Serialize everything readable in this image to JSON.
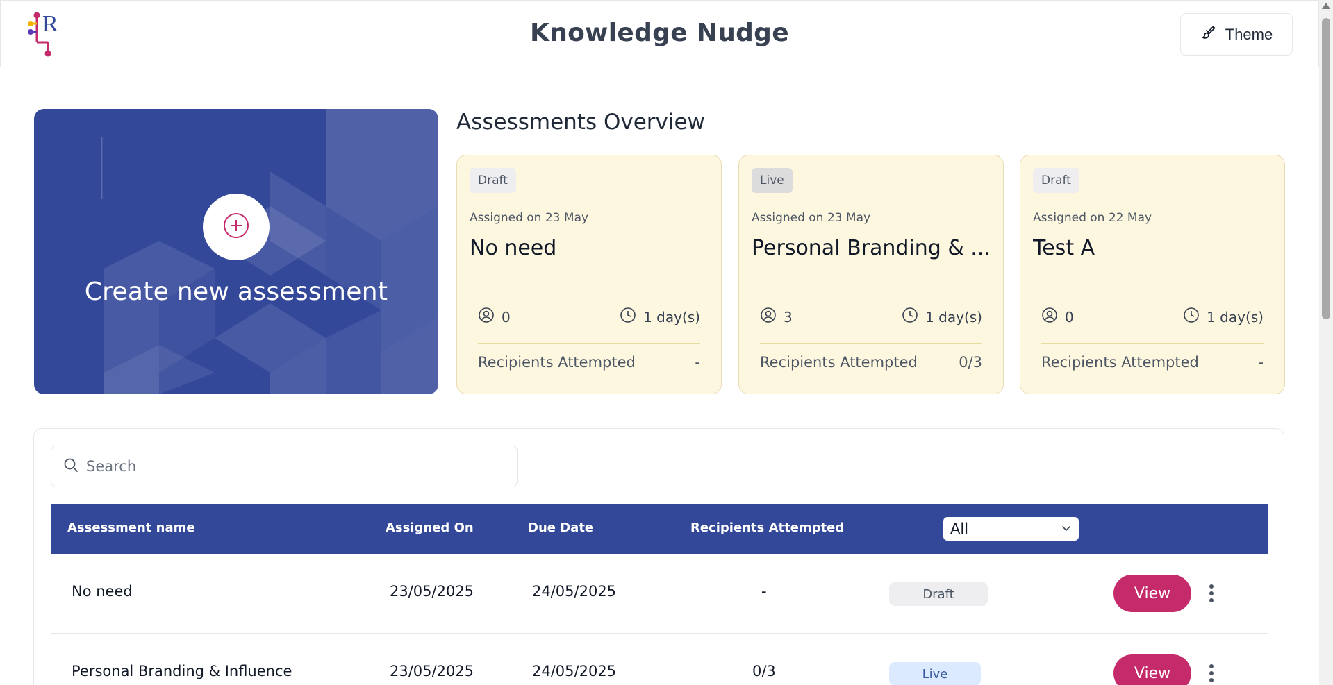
{
  "header": {
    "app_title": "Knowledge Nudge",
    "theme_label": "Theme",
    "logo_icon": "lr-logo-icon",
    "theme_icon": "paintbrush-icon"
  },
  "create_card": {
    "label": "Create new assessment",
    "icon": "plus-circle-icon",
    "accent_color": "#c52a6b",
    "bg_color": "#34489a"
  },
  "overview": {
    "title": "Assessments Overview",
    "cards": [
      {
        "status": "Draft",
        "assigned": "Assigned on 23 May",
        "name": "No need",
        "recipients": "0",
        "duration": "1 day(s)",
        "attempted_label": "Recipients Attempted",
        "attempted_value": "-"
      },
      {
        "status": "Live",
        "assigned": "Assigned on 23 May",
        "name": "Personal Branding & ...",
        "recipients": "3",
        "duration": "1 day(s)",
        "attempted_label": "Recipients Attempted",
        "attempted_value": "0/3"
      },
      {
        "status": "Draft",
        "assigned": "Assigned on 22 May",
        "name": "Test A",
        "recipients": "0",
        "duration": "1 day(s)",
        "attempted_label": "Recipients Attempted",
        "attempted_value": "-"
      }
    ]
  },
  "search": {
    "placeholder": "Search"
  },
  "table": {
    "columns": [
      "Assessment name",
      "Assigned On",
      "Due Date",
      "Recipients Attempted"
    ],
    "status_filter": {
      "selected": "All"
    },
    "rows": [
      {
        "name": "No need",
        "assigned_on": "23/05/2025",
        "due_date": "24/05/2025",
        "attempted": "-",
        "status": "Draft",
        "action": "View"
      },
      {
        "name": "Personal Branding & Influence",
        "assigned_on": "23/05/2025",
        "due_date": "24/05/2025",
        "attempted": "0/3",
        "status": "Live",
        "action": "View"
      }
    ]
  },
  "colors": {
    "primary": "#34489a",
    "accent": "#c52a6b",
    "card_bg": "#fef7e0",
    "live_pill": "#dbeafe"
  }
}
